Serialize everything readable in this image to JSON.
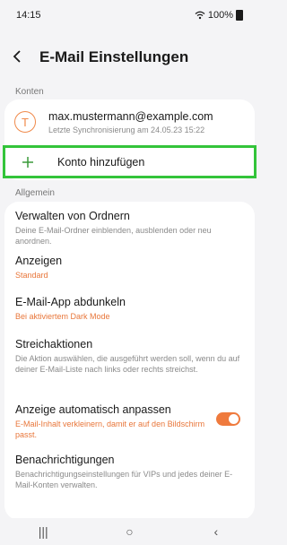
{
  "status": {
    "time": "14:15",
    "battery_text": "100%",
    "wifi_icon": "wifi-icon"
  },
  "header": {
    "back_icon": "back-arrow-icon",
    "title": "E-Mail Einstellungen"
  },
  "accounts_section": {
    "label": "Konten",
    "account": {
      "avatar_letter": "T",
      "email": "max.mustermann@example.com",
      "sync": "Letzte Synchronisierung am 24.05.23  15:22"
    },
    "add_account": {
      "icon": "plus-icon",
      "label": "Konto hinzufügen"
    }
  },
  "general_section": {
    "label": "Allgemein",
    "items": [
      {
        "title": "Verwalten von Ordnern",
        "desc": "Deine E-Mail-Ordner einblenden, ausblenden oder neu anordnen."
      },
      {
        "title": "Anzeigen",
        "desc": "Standard"
      },
      {
        "title": "E-Mail-App abdunkeln",
        "desc": "Bei aktiviertem Dark Mode"
      },
      {
        "title": "Streichaktionen",
        "desc": "Die Aktion auswählen, die ausgeführt werden soll, wenn du auf deiner E-Mail-Liste nach links oder rechts streichst."
      },
      {
        "title": "Anzeige automatisch anpassen",
        "desc": "E-Mail-Inhalt verkleinern, damit er auf den Bildschirm passt.",
        "toggle_on": true
      },
      {
        "title": "Benachrichtigungen",
        "desc": "Benachrichtigungseinstellungen für VIPs und jedes deiner E-Mail-Konten verwalten."
      }
    ]
  },
  "navbar": {
    "recents": "|||",
    "home": "○",
    "back": "‹"
  },
  "colors": {
    "accent": "#ef7a3d",
    "highlight": "#33c43a"
  }
}
